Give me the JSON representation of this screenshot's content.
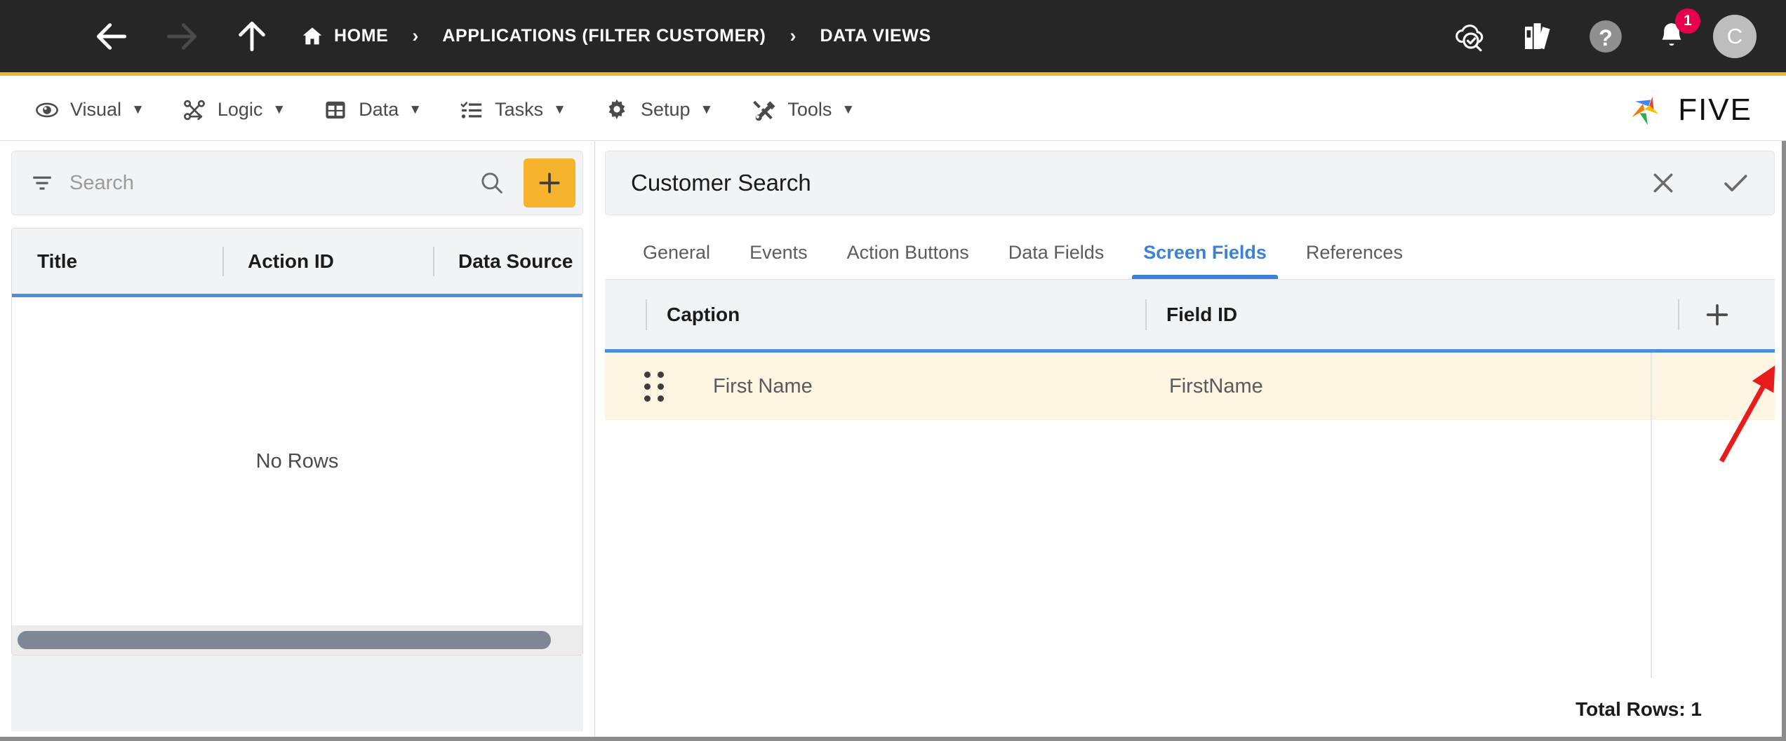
{
  "topbar": {
    "menu_icon": "hamburger-icon",
    "back_icon": "arrow-left-icon",
    "forward_icon": "arrow-right-icon",
    "up_icon": "arrow-up-icon",
    "breadcrumb": [
      {
        "label": "HOME",
        "icon": "home-icon"
      },
      {
        "label": "APPLICATIONS (FILTER CUSTOMER)",
        "icon": ""
      },
      {
        "label": "DATA VIEWS",
        "icon": ""
      }
    ],
    "separator": "›",
    "actions": [
      {
        "name": "cloud-check-icon",
        "label": ""
      },
      {
        "name": "books-icon",
        "label": ""
      },
      {
        "name": "help-icon",
        "label": ""
      },
      {
        "name": "bell-icon",
        "label": "",
        "badge": "1"
      }
    ],
    "avatar_initial": "C",
    "accent_color": "#F5B32E",
    "badge_color": "#E8004C",
    "background": "#262626"
  },
  "menubar": {
    "items": [
      {
        "label": "Visual",
        "icon": "eye-icon",
        "caret": "▼"
      },
      {
        "label": "Logic",
        "icon": "flow-icon",
        "caret": "▼"
      },
      {
        "label": "Data",
        "icon": "table-icon",
        "caret": "▼"
      },
      {
        "label": "Tasks",
        "icon": "checklist-icon",
        "caret": "▼"
      },
      {
        "label": "Setup",
        "icon": "gear-icon",
        "caret": "▼"
      },
      {
        "label": "Tools",
        "icon": "tools-icon",
        "caret": "▼"
      }
    ],
    "logo_text": "FIVE"
  },
  "left_panel": {
    "search": {
      "placeholder": "Search",
      "value": "",
      "filter_icon": "filter-icon",
      "search_icon": "search-icon"
    },
    "add_button_label": "+",
    "grid": {
      "columns": [
        "Title",
        "Action ID",
        "Data Source"
      ],
      "rows": [],
      "empty_message": "No Rows"
    }
  },
  "right_panel": {
    "title": "Customer Search",
    "close_label": "✕",
    "confirm_label": "✓",
    "tabs": [
      {
        "label": "General",
        "active": false
      },
      {
        "label": "Events",
        "active": false
      },
      {
        "label": "Action Buttons",
        "active": false
      },
      {
        "label": "Data Fields",
        "active": false
      },
      {
        "label": "Screen Fields",
        "active": true
      },
      {
        "label": "References",
        "active": false
      }
    ],
    "grid": {
      "columns": [
        "Caption",
        "Field ID"
      ],
      "add_label": "+",
      "rows": [
        {
          "caption": "First Name",
          "field_id": "FirstName"
        }
      ],
      "footer": "Total Rows: 1"
    },
    "active_tab_color": "#3b82d6",
    "row_highlight_color": "#FDF4E2"
  },
  "annotation": {
    "type": "arrow",
    "color": "#E81C1C",
    "points_to": "add-screen-field-button"
  }
}
